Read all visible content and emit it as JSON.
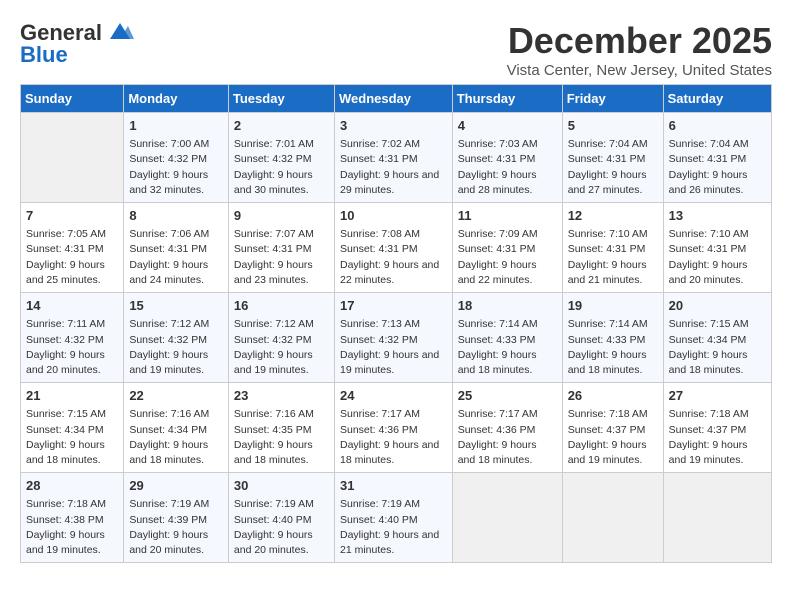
{
  "header": {
    "logo_line1": "General",
    "logo_line2": "Blue",
    "month": "December 2025",
    "location": "Vista Center, New Jersey, United States"
  },
  "days_of_week": [
    "Sunday",
    "Monday",
    "Tuesday",
    "Wednesday",
    "Thursday",
    "Friday",
    "Saturday"
  ],
  "weeks": [
    [
      {
        "day": "",
        "empty": true
      },
      {
        "day": "1",
        "sunrise": "7:00 AM",
        "sunset": "4:32 PM",
        "daylight": "9 hours and 32 minutes."
      },
      {
        "day": "2",
        "sunrise": "7:01 AM",
        "sunset": "4:32 PM",
        "daylight": "9 hours and 30 minutes."
      },
      {
        "day": "3",
        "sunrise": "7:02 AM",
        "sunset": "4:31 PM",
        "daylight": "9 hours and 29 minutes."
      },
      {
        "day": "4",
        "sunrise": "7:03 AM",
        "sunset": "4:31 PM",
        "daylight": "9 hours and 28 minutes."
      },
      {
        "day": "5",
        "sunrise": "7:04 AM",
        "sunset": "4:31 PM",
        "daylight": "9 hours and 27 minutes."
      },
      {
        "day": "6",
        "sunrise": "7:04 AM",
        "sunset": "4:31 PM",
        "daylight": "9 hours and 26 minutes."
      }
    ],
    [
      {
        "day": "7",
        "sunrise": "7:05 AM",
        "sunset": "4:31 PM",
        "daylight": "9 hours and 25 minutes."
      },
      {
        "day": "8",
        "sunrise": "7:06 AM",
        "sunset": "4:31 PM",
        "daylight": "9 hours and 24 minutes."
      },
      {
        "day": "9",
        "sunrise": "7:07 AM",
        "sunset": "4:31 PM",
        "daylight": "9 hours and 23 minutes."
      },
      {
        "day": "10",
        "sunrise": "7:08 AM",
        "sunset": "4:31 PM",
        "daylight": "9 hours and 22 minutes."
      },
      {
        "day": "11",
        "sunrise": "7:09 AM",
        "sunset": "4:31 PM",
        "daylight": "9 hours and 22 minutes."
      },
      {
        "day": "12",
        "sunrise": "7:10 AM",
        "sunset": "4:31 PM",
        "daylight": "9 hours and 21 minutes."
      },
      {
        "day": "13",
        "sunrise": "7:10 AM",
        "sunset": "4:31 PM",
        "daylight": "9 hours and 20 minutes."
      }
    ],
    [
      {
        "day": "14",
        "sunrise": "7:11 AM",
        "sunset": "4:32 PM",
        "daylight": "9 hours and 20 minutes."
      },
      {
        "day": "15",
        "sunrise": "7:12 AM",
        "sunset": "4:32 PM",
        "daylight": "9 hours and 19 minutes."
      },
      {
        "day": "16",
        "sunrise": "7:12 AM",
        "sunset": "4:32 PM",
        "daylight": "9 hours and 19 minutes."
      },
      {
        "day": "17",
        "sunrise": "7:13 AM",
        "sunset": "4:32 PM",
        "daylight": "9 hours and 19 minutes."
      },
      {
        "day": "18",
        "sunrise": "7:14 AM",
        "sunset": "4:33 PM",
        "daylight": "9 hours and 18 minutes."
      },
      {
        "day": "19",
        "sunrise": "7:14 AM",
        "sunset": "4:33 PM",
        "daylight": "9 hours and 18 minutes."
      },
      {
        "day": "20",
        "sunrise": "7:15 AM",
        "sunset": "4:34 PM",
        "daylight": "9 hours and 18 minutes."
      }
    ],
    [
      {
        "day": "21",
        "sunrise": "7:15 AM",
        "sunset": "4:34 PM",
        "daylight": "9 hours and 18 minutes."
      },
      {
        "day": "22",
        "sunrise": "7:16 AM",
        "sunset": "4:34 PM",
        "daylight": "9 hours and 18 minutes."
      },
      {
        "day": "23",
        "sunrise": "7:16 AM",
        "sunset": "4:35 PM",
        "daylight": "9 hours and 18 minutes."
      },
      {
        "day": "24",
        "sunrise": "7:17 AM",
        "sunset": "4:36 PM",
        "daylight": "9 hours and 18 minutes."
      },
      {
        "day": "25",
        "sunrise": "7:17 AM",
        "sunset": "4:36 PM",
        "daylight": "9 hours and 18 minutes."
      },
      {
        "day": "26",
        "sunrise": "7:18 AM",
        "sunset": "4:37 PM",
        "daylight": "9 hours and 19 minutes."
      },
      {
        "day": "27",
        "sunrise": "7:18 AM",
        "sunset": "4:37 PM",
        "daylight": "9 hours and 19 minutes."
      }
    ],
    [
      {
        "day": "28",
        "sunrise": "7:18 AM",
        "sunset": "4:38 PM",
        "daylight": "9 hours and 19 minutes."
      },
      {
        "day": "29",
        "sunrise": "7:19 AM",
        "sunset": "4:39 PM",
        "daylight": "9 hours and 20 minutes."
      },
      {
        "day": "30",
        "sunrise": "7:19 AM",
        "sunset": "4:40 PM",
        "daylight": "9 hours and 20 minutes."
      },
      {
        "day": "31",
        "sunrise": "7:19 AM",
        "sunset": "4:40 PM",
        "daylight": "9 hours and 21 minutes."
      },
      {
        "day": "",
        "empty": true
      },
      {
        "day": "",
        "empty": true
      },
      {
        "day": "",
        "empty": true
      }
    ]
  ],
  "labels": {
    "sunrise": "Sunrise: ",
    "sunset": "Sunset: ",
    "daylight": "Daylight: "
  }
}
